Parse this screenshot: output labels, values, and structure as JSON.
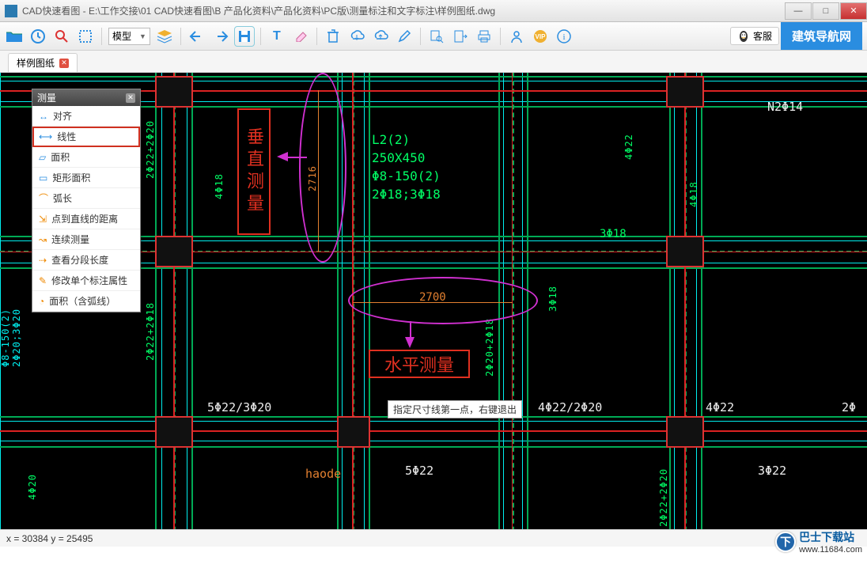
{
  "window": {
    "title": "CAD快速看图 - E:\\工作交接\\01 CAD快速看图\\B 产品化资料\\产品化资料\\PC版\\测量标注和文字标注\\样例图纸.dwg",
    "min": "—",
    "max": "□",
    "close": "✕"
  },
  "toolbar": {
    "combo_label": "模型",
    "kefu": "客服",
    "navsite": "建筑导航网"
  },
  "tabs": {
    "active": "样例图纸"
  },
  "measure_panel": {
    "title": "测量",
    "items": [
      "对齐",
      "线性",
      "面积",
      "矩形面积",
      "弧长",
      "点到直线的距离",
      "连续测量",
      "查看分段长度",
      "修改单个标注属性",
      "面积（含弧线）"
    ],
    "selected_index": 1
  },
  "annotations": {
    "vertical_box": "垂直测量",
    "horizontal_box": "水平测量",
    "dim_v": "2716",
    "dim_h": "2700"
  },
  "beam_info": {
    "l1": "L2(2)",
    "l2": "250X450",
    "l3": "Φ8-150(2)",
    "l4": "2Φ18;3Φ18"
  },
  "labels": {
    "c1": "2Φ22+2Φ20",
    "c2": "4Φ18",
    "c3": "4Φ22",
    "c4": "N2Φ14",
    "c5": "4Φ18",
    "c6": "3Φ18",
    "c7": "3Φ18",
    "c8": "2Φ20+2Φ18",
    "c9": "2Φ22+2Φ18",
    "c10": "5Φ22/3Φ20",
    "c11": "4Φ22/2Φ20",
    "c12": "4Φ22",
    "c13": "2Φ",
    "c14": "5Φ22",
    "c15": "3Φ22",
    "c16": "2Φ22+2Φ20",
    "c17": "4Φ20",
    "c18": "Φ8-150(2)",
    "c19": "2Φ20;3Φ20",
    "c20": "haode"
  },
  "tooltip": "指定尺寸线第一点，右键退出",
  "status": {
    "coords": "x = 30384  y = 25495"
  },
  "watermark": {
    "name": "巴士下载站",
    "url": "www.11684.com"
  }
}
